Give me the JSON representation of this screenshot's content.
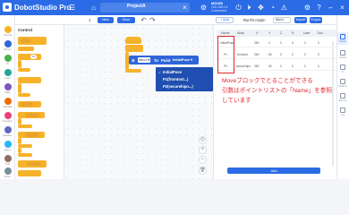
{
  "app": {
    "title": "DobotStudio Pro"
  },
  "topbar": {
    "project_tab": "ProjectA",
    "device_name": "MG400",
    "device_status_1": "192.168.1.6",
    "device_status_2": "Connected"
  },
  "toolbar": {
    "new_label": "New",
    "save_label": "Save",
    "import_label": "Import",
    "export_label": "Export",
    "run_label": "Run",
    "run_mode_label": "RunTo mode:",
    "run_mode_value": "MovJ",
    "points_add_label": "+ Add"
  },
  "categories": [
    {
      "label": "Control",
      "color": "#f7b22b"
    },
    {
      "label": "Motion",
      "color": "#2f66d8"
    },
    {
      "label": "IO",
      "color": "#4caf50"
    },
    {
      "label": "Logic",
      "color": "#26a69a"
    },
    {
      "label": "Math",
      "color": "#7e57c2"
    },
    {
      "label": "Variable",
      "color": "#ef6c00"
    },
    {
      "label": "Function",
      "color": "#ec407a"
    },
    {
      "label": "Modbus",
      "color": "#5c6bc0"
    },
    {
      "label": "Vision",
      "color": "#29b6f6"
    },
    {
      "label": "TCP",
      "color": "#8d6e63"
    },
    {
      "label": "Other",
      "color": "#78909c"
    }
  ],
  "palette": {
    "title": "Control",
    "repeat_value": "10",
    "wait_label": "Wait",
    "set_label": "Set",
    "sync_label": "Sync",
    "end_label": "End"
  },
  "canvas": {
    "start_label": "Start",
    "move_label": "MovJ",
    "to_label": "To",
    "point_label": "Point",
    "point_value": "InitialPose",
    "menu_items": [
      "InitialPose",
      "P1(fromtool...)",
      "P2(securehipo...)"
    ]
  },
  "points_table": {
    "headers": [
      "Name",
      "Alias",
      "X",
      "Y",
      "Z",
      "R",
      "User",
      "Tool"
    ],
    "rows": [
      [
        "InitialPose",
        "",
        "350",
        "0",
        "0",
        "0",
        "0",
        "0"
      ],
      [
        "P1",
        "fromtool",
        "350",
        "-50",
        "0",
        "0",
        "0",
        "0"
      ],
      [
        "P2",
        "securehipo",
        "350",
        "50",
        "0",
        "0",
        "0",
        "0"
      ]
    ]
  },
  "annotation": {
    "line1": "Moveブロックでとることができる",
    "line2": "引数はポイントリストの「Name」を参照",
    "line3": "しています"
  },
  "add_button": "Add",
  "right_sidebar": [
    {
      "label": "Points",
      "active": true
    },
    {
      "label": "Global",
      "active": false
    },
    {
      "label": "IO",
      "active": false
    },
    {
      "label": "Modbus",
      "active": false
    },
    {
      "label": "Record",
      "active": false
    },
    {
      "label": "Log",
      "active": false
    }
  ]
}
